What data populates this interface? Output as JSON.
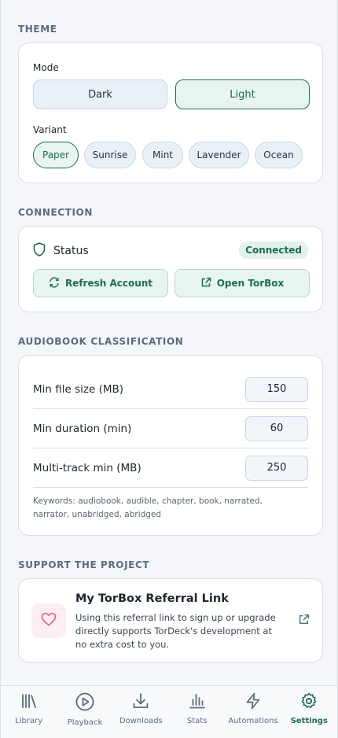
{
  "theme": {
    "title": "THEME",
    "mode_label": "Mode",
    "modes": [
      {
        "label": "Dark",
        "active": false
      },
      {
        "label": "Light",
        "active": true
      }
    ],
    "variant_label": "Variant",
    "variants": [
      {
        "label": "Paper",
        "active": true
      },
      {
        "label": "Sunrise",
        "active": false
      },
      {
        "label": "Mint",
        "active": false
      },
      {
        "label": "Lavender",
        "active": false
      },
      {
        "label": "Ocean",
        "active": false
      }
    ]
  },
  "connection": {
    "title": "CONNECTION",
    "status_label": "Status",
    "status_value": "Connected",
    "refresh_button": "Refresh Account",
    "open_button": "Open TorBox"
  },
  "audiobook": {
    "title": "AUDIOBOOK CLASSIFICATION",
    "rows": [
      {
        "label": "Min file size (MB)",
        "value": "150"
      },
      {
        "label": "Min duration (min)",
        "value": "60"
      },
      {
        "label": "Multi-track min (MB)",
        "value": "250"
      }
    ],
    "keywords": "Keywords: audiobook, audible, chapter, book, narrated, narrator, unabridged, abridged"
  },
  "support": {
    "title": "SUPPORT THE PROJECT",
    "referral_title": "My TorBox Referral Link",
    "referral_desc": "Using this referral link to sign up or upgrade directly supports TorDeck's development at no extra cost to you."
  },
  "nav": {
    "items": [
      {
        "label": "Library",
        "icon": "library-icon",
        "active": false
      },
      {
        "label": "Playback",
        "icon": "play-circle-icon",
        "active": false
      },
      {
        "label": "Downloads",
        "icon": "download-icon",
        "active": false
      },
      {
        "label": "Stats",
        "icon": "bar-chart-icon",
        "active": false
      },
      {
        "label": "Automations",
        "icon": "lightning-icon",
        "active": false
      },
      {
        "label": "Settings",
        "icon": "gear-icon",
        "active": true
      }
    ]
  },
  "colors": {
    "accent": "#1f6b57",
    "background": "#f4f6f9",
    "card": "#ffffff",
    "referral_heart": "#e75a86"
  }
}
